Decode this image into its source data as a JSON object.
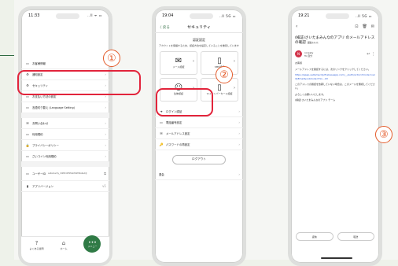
{
  "phone1": {
    "time": "11:33",
    "status": "..ll ᯤ ▭",
    "items": [
      {
        "icon": "▭",
        "label": "お客様情報"
      },
      {
        "icon": "⚙",
        "label": "通知設定"
      },
      {
        "icon": "⚙",
        "label": "セキュリティ"
      },
      {
        "icon": "▭",
        "label": "お支払い方法の設定"
      },
      {
        "icon": "▭",
        "label": "言語切り替え (Language Setting)"
      }
    ],
    "items2": [
      {
        "icon": "✉",
        "label": "お問い合わせ"
      },
      {
        "icon": "▭",
        "label": "利用規約"
      },
      {
        "icon": "🔒",
        "label": "プライバシーポリシー"
      },
      {
        "icon": "▭",
        "label": "さいコイン利用規約"
      }
    ],
    "user_label": "ユーザーID",
    "user_id": "saitamacity_r6bf8cd05f0a6392f09a9ed@",
    "version_label": "アプリバージョン",
    "version_value": "v1",
    "nav": [
      {
        "icon": "?",
        "label": "よくある質問"
      },
      {
        "icon": "⌂",
        "label": "ホーム"
      }
    ],
    "menu_label": "メニュー",
    "badge": "①"
  },
  "phone2": {
    "time": "19:04",
    "status": "..ll 5G ▭",
    "back": "〈 戻る",
    "title": "セキュリティ",
    "section_title": "認証設定",
    "desc": "アカウントを保護するため、認証方法を設定していることを推奨しています",
    "cards": [
      {
        "icon": "✉",
        "label": "メール認証"
      },
      {
        "icon": "▯",
        "label": "SMS認証"
      },
      {
        "icon": "☺",
        "label": "生体認証"
      },
      {
        "icon": "▯",
        "label": "マイナンバーカード認証"
      }
    ],
    "items": [
      {
        "icon": "➜",
        "label": "ログイン認証"
      },
      {
        "icon": "▭",
        "label": "電話番号設定"
      },
      {
        "icon": "✉",
        "label": "メールアドレス設定"
      },
      {
        "icon": "🔑",
        "label": "パスワードの再設定"
      }
    ],
    "logout": "ログアウト",
    "withdraw": "退会",
    "badge": "②"
  },
  "phone3": {
    "time": "19:21",
    "status": "..ll 5G ▭",
    "subject": "(検証)さいたまみんなのアプリ のメールアドレスの確認",
    "tag": "受信トレイ",
    "from": "noreply",
    "to": "To 自分",
    "greeting": "お客様",
    "body1": "メールアドレスを確認するには、次のリンクをクリックしてください。",
    "link": "https://ppap-saitamacity.firebaseapp.com/__/auth/action?mode=verifyEmail&oobCode=f1n...UV",
    "body2": "このアドレスの確認を依頼していない場合は、このメールを無視してください。",
    "body3": "よろしくお願いいたします。",
    "sign": "(検証)さいたまみんなのアプリ チーム",
    "reply": "返信",
    "forward": "転送",
    "badge": "③"
  }
}
